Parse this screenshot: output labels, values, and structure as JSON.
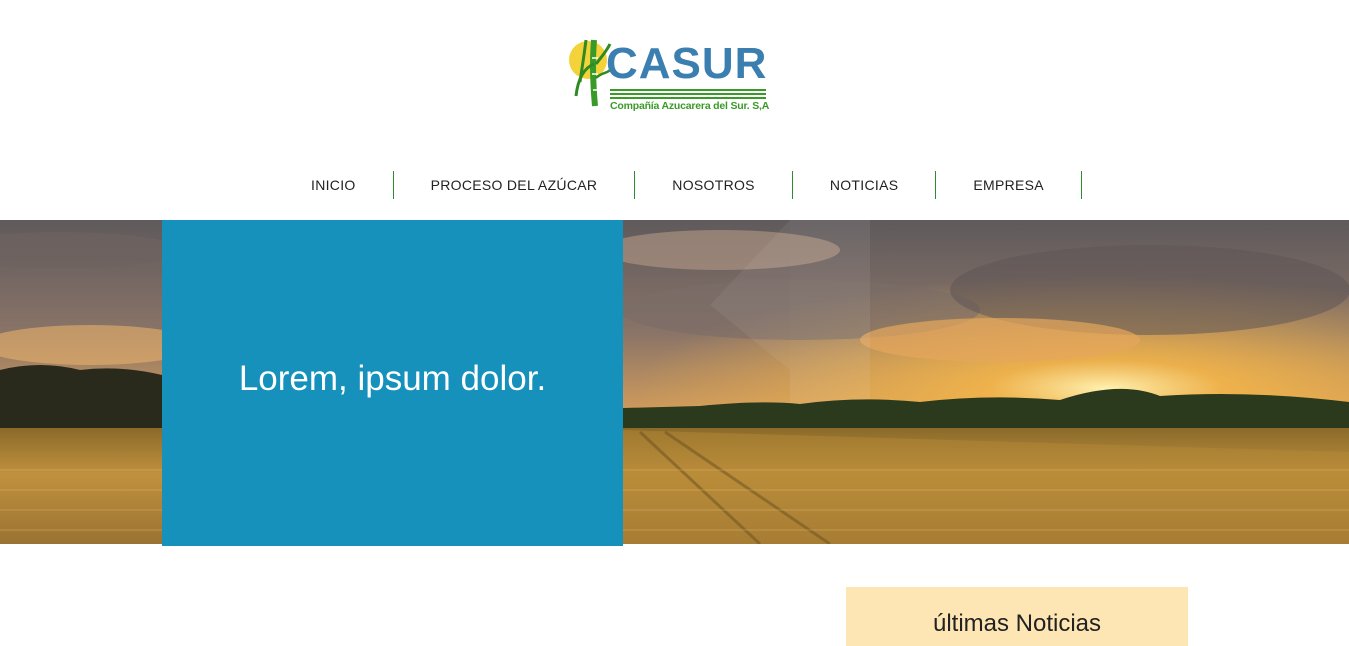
{
  "brand": {
    "name": "CASUR",
    "tagline": "Compañía Azucarera del Sur. S,A",
    "colors": {
      "word": "#3a7fb0",
      "green": "#3a9a28",
      "sun": "#f3d23a"
    }
  },
  "nav": {
    "items": [
      {
        "label": "INICIO"
      },
      {
        "label": "PROCESO DEL AZÚCAR"
      },
      {
        "label": "NOSOTROS"
      },
      {
        "label": "NOTICIAS"
      },
      {
        "label": "EMPRESA"
      }
    ],
    "separator_color": "#2e8b2e"
  },
  "hero": {
    "title": "Lorem, ipsum dolor.",
    "box_color": "#1591bc",
    "image": "sunset-wheat-field"
  },
  "news": {
    "title": "últimas Noticias",
    "card_color": "#fde6b4"
  }
}
